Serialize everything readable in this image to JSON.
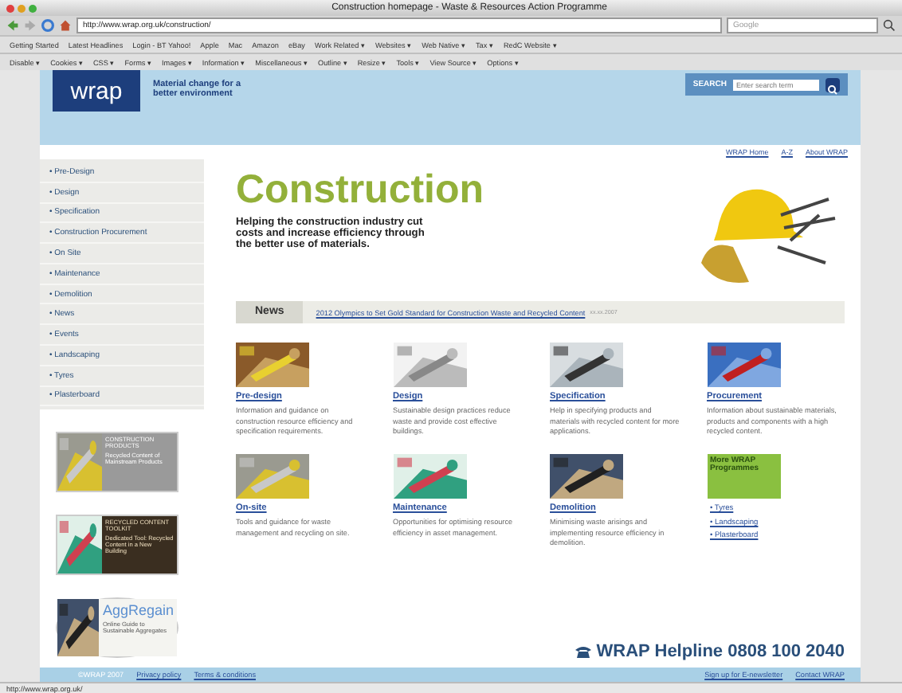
{
  "window": {
    "title": "Construction homepage - Waste & Resources Action Programme"
  },
  "toolbar": {
    "url": "http://www.wrap.org.uk/construction/",
    "search_placeholder": "Google"
  },
  "bookmarks": [
    "Getting Started",
    "Latest Headlines",
    "Login - BT Yahoo!",
    "Apple",
    "Mac",
    "Amazon",
    "eBay",
    "Work Related ▾",
    "Websites ▾",
    "Web Native ▾",
    "Tax ▾",
    "RedC Website ▾"
  ],
  "dev_toolbar": [
    "Disable ▾",
    "Cookies ▾",
    "CSS ▾",
    "Forms ▾",
    "Images ▾",
    "Information ▾",
    "Miscellaneous ▾",
    "Outline ▾",
    "Resize ▾",
    "Tools ▾",
    "View Source ▾",
    "Options ▾"
  ],
  "header": {
    "logo": "wrap",
    "tagline": "Material change for a better environment",
    "search_label": "SEARCH",
    "search_placeholder": "Enter search term",
    "links": [
      "WRAP Home",
      "A-Z",
      "About WRAP"
    ]
  },
  "sidebar": {
    "items": [
      "• Pre-Design",
      "• Design",
      "• Specification",
      "• Construction Procurement",
      "• On Site",
      "• Maintenance",
      "• Demolition",
      "• News",
      "• Events",
      "• Landscaping",
      "• Tyres",
      "• Plasterboard"
    ],
    "promos": [
      {
        "kind": "dark",
        "heading": "CONSTRUCTION PRODUCTS",
        "text": "Recycled Content of Mainstream Products"
      },
      {
        "kind": "brown",
        "heading": "RECYCLED CONTENT TOOLKIT",
        "text": "Dedicated Tool: Recycled Content in a New Building"
      },
      {
        "kind": "light",
        "heading": "AggRegain",
        "text": "Online Guide to Sustainable Aggregates"
      }
    ]
  },
  "hero": {
    "title": "Construction",
    "text": "Helping the construction industry cut costs and increase efficiency through the better use of materials."
  },
  "news": {
    "label": "News",
    "headline": "2012 Olympics to Set Gold Standard for Construction Waste and Recycled Content",
    "date": "xx.xx.2007"
  },
  "cards": [
    {
      "kind": "article",
      "title": "Pre-design",
      "text": "Information and guidance on construction resource efficiency and specification requirements."
    },
    {
      "kind": "article",
      "title": "Design",
      "text": "Sustainable design practices reduce waste and provide cost effective buildings."
    },
    {
      "kind": "article",
      "title": "Specification",
      "text": "Help in specifying products and materials with recycled content for more applications."
    },
    {
      "kind": "article",
      "title": "Procurement",
      "text": "Information about sustainable materials, products and components with a high recycled content."
    },
    {
      "kind": "article",
      "title": "On-site",
      "text": "Tools and guidance for waste management and recycling on site."
    },
    {
      "kind": "article",
      "title": "Maintenance",
      "text": "Opportunities for optimising resource efficiency in asset management."
    },
    {
      "kind": "article",
      "title": "Demolition",
      "text": "Minimising waste arisings and implementing resource efficiency in demolition."
    },
    {
      "kind": "links",
      "title": "More WRAP Programmes",
      "links": [
        "• Tyres",
        "• Landscaping",
        "• Plasterboard"
      ]
    }
  ],
  "helpline": "WRAP Helpline 0808 100 2040",
  "footer": {
    "left": [
      "©WRAP 2007",
      "Privacy policy",
      "Terms & conditions"
    ],
    "right": [
      "Sign up for E-newsletter",
      "Contact WRAP"
    ]
  },
  "status_bar": "http://www.wrap.org.uk/"
}
